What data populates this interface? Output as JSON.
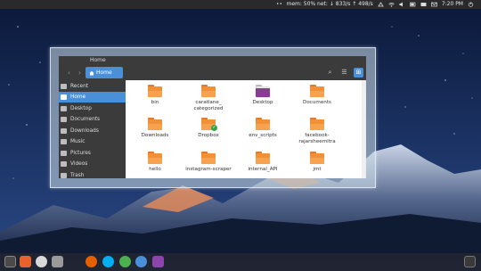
{
  "top_panel": {
    "indicator_text": "mem: 50% net: ↓ 833/s ↑ 498/s",
    "time": "7:20 PM",
    "icons": [
      "dropbox-icon",
      "network-icon",
      "wifi-icon",
      "volume-icon",
      "battery-icon",
      "keyboard-icon",
      "mail-icon",
      "power-icon"
    ]
  },
  "window": {
    "title": "Home",
    "toolbar": {
      "back": "‹",
      "forward": "›",
      "path_button": "Home",
      "search": "⌕",
      "list_view": "☰",
      "grid_view": "⊞"
    },
    "sidebar": [
      {
        "label": "Recent",
        "icon": "clock-icon",
        "selected": false
      },
      {
        "label": "Home",
        "icon": "home-icon",
        "selected": true
      },
      {
        "label": "Desktop",
        "icon": "desktop-icon",
        "selected": false
      },
      {
        "label": "Documents",
        "icon": "document-icon",
        "selected": false
      },
      {
        "label": "Downloads",
        "icon": "download-icon",
        "selected": false
      },
      {
        "label": "Music",
        "icon": "music-icon",
        "selected": false
      },
      {
        "label": "Pictures",
        "icon": "picture-icon",
        "selected": false
      },
      {
        "label": "Videos",
        "icon": "video-icon",
        "selected": false
      },
      {
        "label": "Trash",
        "icon": "trash-icon",
        "selected": false
      }
    ],
    "files": [
      {
        "name": "bin"
      },
      {
        "name": "caratlane_\ncategorized"
      },
      {
        "name": "Desktop"
      },
      {
        "name": "Documents"
      },
      {
        "name": "Downloads"
      },
      {
        "name": "Dropbox"
      },
      {
        "name": "env_scripts"
      },
      {
        "name": "facebook-\nrajarsheemitra"
      },
      {
        "name": "hello"
      },
      {
        "name": "instagram-scraper"
      },
      {
        "name": "internal_API"
      },
      {
        "name": "jmt"
      }
    ]
  },
  "dock": {
    "apps": [
      "files-icon",
      "store-icon",
      "settings-icon",
      "disk-icon",
      "firefox-icon",
      "skype-icon",
      "chrome-icon",
      "chromium-icon",
      "mail-app-icon"
    ]
  },
  "colors": {
    "accent": "#4a90d9",
    "folder": "#f0913a",
    "panel": "#3b3b3b"
  }
}
